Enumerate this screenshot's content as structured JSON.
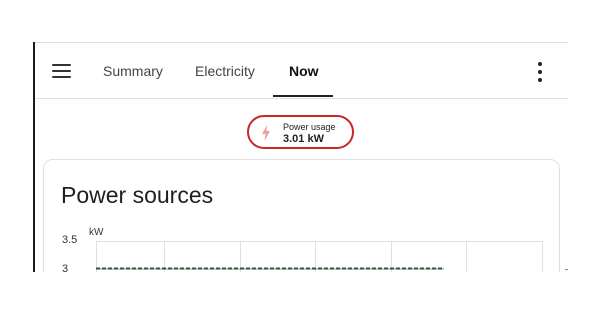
{
  "header": {
    "menu_icon": "hamburger-menu-icon",
    "tabs": [
      {
        "label": "Summary",
        "active": false
      },
      {
        "label": "Electricity",
        "active": false
      },
      {
        "label": "Now",
        "active": true
      }
    ],
    "overflow_icon": "more-vertical-icon"
  },
  "badge": {
    "icon": "lightning-bolt-icon",
    "label": "Power usage",
    "value": "3.01 kW",
    "accent_color": "#c62828"
  },
  "card": {
    "title": "Power sources"
  },
  "chart_data": {
    "type": "line",
    "ylabel": "kW",
    "yticks": [
      "3.5",
      "3"
    ],
    "ylim": [
      3,
      3.5
    ],
    "grid": true,
    "series": [
      {
        "values": [
          3.0,
          3.0,
          3.0,
          3.0,
          3.0,
          3.0
        ],
        "color": "#2e7d32",
        "style": "dashed"
      }
    ]
  }
}
